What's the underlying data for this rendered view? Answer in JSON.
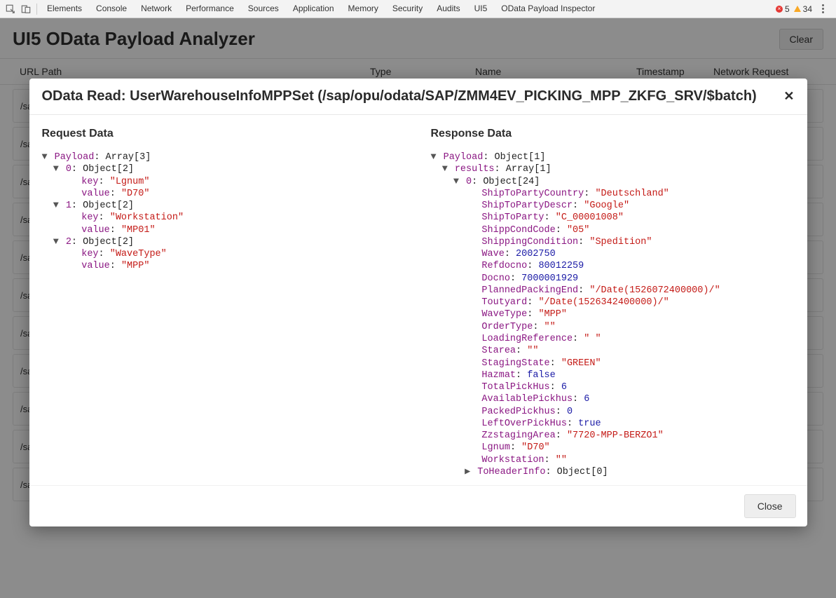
{
  "devtools": {
    "tabs": [
      "Elements",
      "Console",
      "Network",
      "Performance",
      "Sources",
      "Application",
      "Memory",
      "Security",
      "Audits",
      "UI5",
      "OData Payload Inspector"
    ],
    "errors": "5",
    "warnings": "34"
  },
  "app": {
    "title": "UI5 OData Payload Analyzer",
    "clear_label": "Clear",
    "columns": {
      "url": "URL Path",
      "type": "Type",
      "name": "Name",
      "timestamp": "Timestamp",
      "network": "Network Request"
    },
    "row_prefix": "/sa"
  },
  "modal": {
    "title": "OData Read: UserWarehouseInfoMPPSet (/sap/opu/odata/SAP/ZMM4EV_PICKING_MPP_ZKFG_SRV/$batch)",
    "request_heading": "Request Data",
    "response_heading": "Response Data",
    "close_label": "Close",
    "request_payload": [
      {
        "key": "Lgnum",
        "value": "D70"
      },
      {
        "key": "Workstation",
        "value": "MP01"
      },
      {
        "key": "WaveType",
        "value": "MPP"
      }
    ],
    "response_payload": {
      "results_count": 1,
      "object_field_count": 24,
      "fields": [
        {
          "name": "ShipToPartyCountry",
          "value": "\"Deutschland\"",
          "cls": "k-red"
        },
        {
          "name": "ShipToPartyDescr",
          "value": "\"Google\"",
          "cls": "k-red"
        },
        {
          "name": "ShipToParty",
          "value": "\"C_00001008\"",
          "cls": "k-red"
        },
        {
          "name": "ShippCondCode",
          "value": "\"05\"",
          "cls": "k-red"
        },
        {
          "name": "ShippingCondition",
          "value": "\"Spedition\"",
          "cls": "k-red"
        },
        {
          "name": "Wave",
          "value": "2002750",
          "cls": "k-blue"
        },
        {
          "name": "Refdocno",
          "value": "80012259",
          "cls": "k-blue"
        },
        {
          "name": "Docno",
          "value": "7000001929",
          "cls": "k-blue"
        },
        {
          "name": "PlannedPackingEnd",
          "value": "\"/Date(1526072400000)/\"",
          "cls": "k-red"
        },
        {
          "name": "Toutyard",
          "value": "\"/Date(1526342400000)/\"",
          "cls": "k-red"
        },
        {
          "name": "WaveType",
          "value": "\"MPP\"",
          "cls": "k-red"
        },
        {
          "name": "OrderType",
          "value": "\"\"",
          "cls": "k-red"
        },
        {
          "name": "LoadingReference",
          "value": "\" \"",
          "cls": "k-red"
        },
        {
          "name": "Starea",
          "value": "\"\"",
          "cls": "k-red"
        },
        {
          "name": "StagingState",
          "value": "\"GREEN\"",
          "cls": "k-red"
        },
        {
          "name": "Hazmat",
          "value": "false",
          "cls": "k-blue"
        },
        {
          "name": "TotalPickHus",
          "value": "6",
          "cls": "k-blue"
        },
        {
          "name": "AvailablePickhus",
          "value": "6",
          "cls": "k-blue"
        },
        {
          "name": "PackedPickhus",
          "value": "0",
          "cls": "k-blue"
        },
        {
          "name": "LeftOverPickHus",
          "value": "true",
          "cls": "k-blue"
        },
        {
          "name": "ZzstagingArea",
          "value": "\"7720-MPP-BERZO1\"",
          "cls": "k-red"
        },
        {
          "name": "Lgnum",
          "value": "\"D70\"",
          "cls": "k-red"
        },
        {
          "name": "Workstation",
          "value": "\"\"",
          "cls": "k-red"
        }
      ],
      "toheader_label": "ToHeaderInfo",
      "toheader_type": "Object[0]"
    }
  }
}
